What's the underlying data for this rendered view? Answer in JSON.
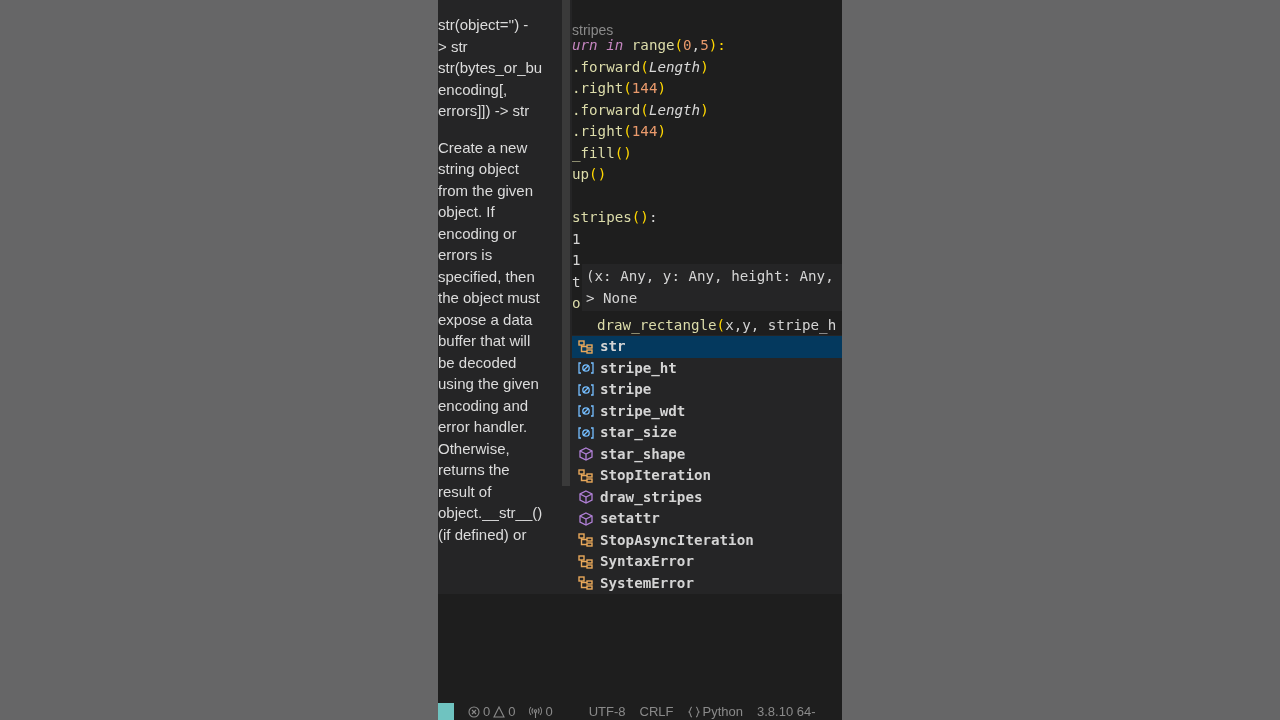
{
  "docs": {
    "signature_lines": [
      "str(object='') -",
      "> str",
      "str(bytes_or_bu",
      "encoding[,",
      "errors]]) -> str"
    ],
    "description": "Create a new string object from the given object. If encoding or errors is specified, then the object must expose a data buffer that will be decoded using the given encoding and error handler. Otherwise, returns the result of object.__str__() (if defined) or"
  },
  "editor": {
    "breadcrumb": "stripes",
    "code_lines": [
      [
        {
          "text": "urn ",
          "kind": "keyword"
        },
        {
          "text": "in ",
          "kind": "keyword"
        },
        {
          "text": "range",
          "kind": "func"
        },
        {
          "text": "(",
          "kind": "paren"
        },
        {
          "text": "0",
          "kind": "num"
        },
        {
          "text": ",",
          "kind": "plain"
        },
        {
          "text": "5",
          "kind": "num"
        },
        {
          "text": "):",
          "kind": "paren"
        }
      ],
      [
        {
          "text": ".forward",
          "kind": "func"
        },
        {
          "text": "(",
          "kind": "paren"
        },
        {
          "text": "Length",
          "kind": "param"
        },
        {
          "text": ")",
          "kind": "paren"
        }
      ],
      [
        {
          "text": ".right",
          "kind": "func"
        },
        {
          "text": "(",
          "kind": "paren"
        },
        {
          "text": "144",
          "kind": "num"
        },
        {
          "text": ")",
          "kind": "paren"
        }
      ],
      [
        {
          "text": ".forward",
          "kind": "func"
        },
        {
          "text": "(",
          "kind": "paren"
        },
        {
          "text": "Length",
          "kind": "param"
        },
        {
          "text": ")",
          "kind": "paren"
        }
      ],
      [
        {
          "text": ".right",
          "kind": "func"
        },
        {
          "text": "(",
          "kind": "paren"
        },
        {
          "text": "144",
          "kind": "num"
        },
        {
          "text": ")",
          "kind": "paren"
        }
      ],
      [
        {
          "text": "_fill",
          "kind": "func"
        },
        {
          "text": "()",
          "kind": "paren"
        }
      ],
      [
        {
          "text": "up",
          "kind": "func"
        },
        {
          "text": "()",
          "kind": "paren"
        }
      ],
      {
        "kind": "blank"
      },
      [
        {
          "text": "stripes",
          "kind": "func"
        },
        {
          "text": "()",
          "kind": "paren"
        },
        {
          "text": ":",
          "kind": "plain"
        }
      ],
      [
        {
          "text": "1",
          "kind": "plain"
        }
      ],
      [
        {
          "text": "1",
          "kind": "plain"
        }
      ],
      [
        {
          "text": "t",
          "kind": "plain"
        }
      ],
      [
        {
          "text": "o",
          "kind": "func"
        }
      ]
    ],
    "hover": {
      "lines": [
        "(x: Any, y: Any, height: Any,",
        "> None"
      ]
    },
    "current_line": [
      {
        "text": "draw_rectangle",
        "kind": "func"
      },
      {
        "text": "(",
        "kind": "paren"
      },
      {
        "text": "x,y, stripe_h",
        "kind": "plain"
      }
    ],
    "suggestions": [
      {
        "label": "str",
        "kind": "class",
        "selected": true
      },
      {
        "label": "stripe_ht",
        "kind": "variable",
        "selected": false
      },
      {
        "label": "stripe",
        "kind": "variable",
        "selected": false
      },
      {
        "label": "stripe_wdt",
        "kind": "variable",
        "selected": false
      },
      {
        "label": "star_size",
        "kind": "variable",
        "selected": false
      },
      {
        "label": "star_shape",
        "kind": "module",
        "selected": false
      },
      {
        "label": "StopIteration",
        "kind": "class",
        "selected": false
      },
      {
        "label": "draw_stripes",
        "kind": "module",
        "selected": false
      },
      {
        "label": "setattr",
        "kind": "module",
        "selected": false
      },
      {
        "label": "StopAsyncIteration",
        "kind": "class",
        "selected": false
      },
      {
        "label": "SyntaxError",
        "kind": "class",
        "selected": false
      },
      {
        "label": "SystemError",
        "kind": "class",
        "selected": false
      }
    ]
  },
  "status_bar": {
    "errors": "0",
    "warnings": "0",
    "ports": "0",
    "encoding": "UTF-8",
    "line_ending": "CRLF",
    "language": "Python",
    "interpreter": "3.8.10 64-"
  }
}
